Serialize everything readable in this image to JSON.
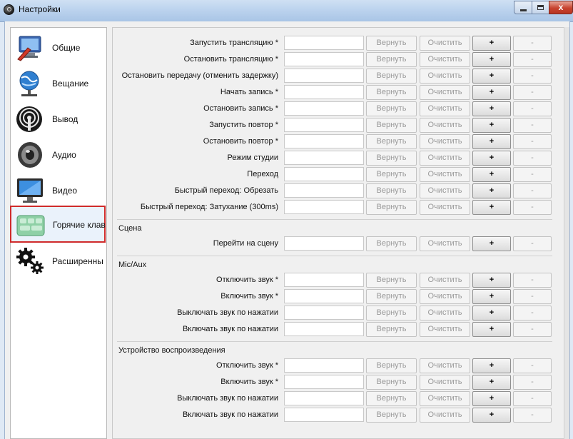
{
  "window": {
    "title": "Настройки",
    "close_glyph": "x",
    "icon": "obs-logo-icon"
  },
  "sidebar": {
    "items": [
      {
        "label": "Общие",
        "icon": "general-settings-icon"
      },
      {
        "label": "Вещание",
        "icon": "stream-globe-icon"
      },
      {
        "label": "Вывод",
        "icon": "output-broadcast-icon"
      },
      {
        "label": "Аудио",
        "icon": "speaker-icon"
      },
      {
        "label": "Видео",
        "icon": "monitor-icon"
      },
      {
        "label": "Горячие клав",
        "icon": "keyboard-icon",
        "selected": true
      },
      {
        "label": "Расширенны",
        "icon": "gears-icon"
      }
    ]
  },
  "buttons": {
    "revert": "Вернуть",
    "clear": "Очистить",
    "add": "+",
    "remove": "-"
  },
  "groups": [
    {
      "title": "",
      "rows": [
        "Запустить трансляцию *",
        "Остановить трансляцию *",
        "Остановить передачу (отменить задержку)",
        "Начать запись *",
        "Остановить запись *",
        "Запустить повтор *",
        "Остановить повтор *",
        "Режим студии",
        "Переход",
        "Быстрый переход: Обрезать",
        "Быстрый переход: Затухание (300ms)"
      ]
    },
    {
      "title": "Сцена",
      "rows": [
        "Перейти на сцену"
      ]
    },
    {
      "title": "Mic/Aux",
      "rows": [
        "Отключить звук *",
        "Включить звук *",
        "Выключать звук по нажатии",
        "Включать звук по нажатии"
      ]
    },
    {
      "title": "Устройство воспроизведения",
      "rows": [
        "Отключить звук *",
        "Включить звук *",
        "Выключать звук по нажатии",
        "Включать звук по нажатии"
      ]
    }
  ],
  "colors": {
    "selection_border": "#d02b2b",
    "titlebar": "#bcd3ee"
  }
}
